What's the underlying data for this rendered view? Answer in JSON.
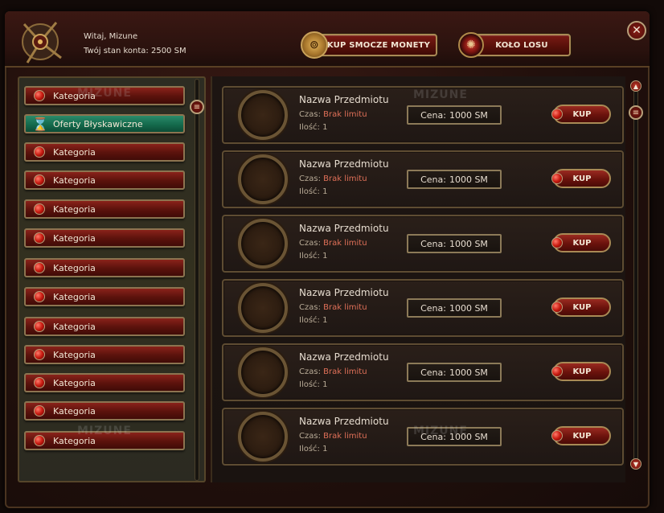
{
  "header": {
    "greeting": "Witaj, Mizune",
    "balance": "Twój stan konta: 2500 SM",
    "buy_coins_label": "KUP SMOCZE MONETY",
    "wheel_label": "KOŁO LOSU",
    "close_symbol": "✕"
  },
  "sidebar": {
    "items": [
      {
        "label": "Kategoria",
        "active": false
      },
      {
        "label": "Oferty Błyskawiczne",
        "active": true
      },
      {
        "label": "Kategoria",
        "active": false
      },
      {
        "label": "Kategoria",
        "active": false
      },
      {
        "label": "Kategoria",
        "active": false
      },
      {
        "label": "Kategoria",
        "active": false
      },
      {
        "label": "Kategoria",
        "active": false
      },
      {
        "label": "Kategoria",
        "active": false
      },
      {
        "label": "Kategoria",
        "active": false
      },
      {
        "label": "Kategoria",
        "active": false
      },
      {
        "label": "Kategoria",
        "active": false
      },
      {
        "label": "Kategoria",
        "active": false
      },
      {
        "label": "Kategoria",
        "active": false
      }
    ]
  },
  "items": [
    {
      "name": "Nazwa Przedmiotu",
      "time_label": "Czas:",
      "time_value": "Brak limitu",
      "qty": "Ilość: 1",
      "price_label": "Cena:",
      "price_value": "1000 SM",
      "buy_label": "KUP"
    },
    {
      "name": "Nazwa Przedmiotu",
      "time_label": "Czas:",
      "time_value": "Brak limitu",
      "qty": "Ilość: 1",
      "price_label": "Cena:",
      "price_value": "1000 SM",
      "buy_label": "KUP"
    },
    {
      "name": "Nazwa Przedmiotu",
      "time_label": "Czas:",
      "time_value": "Brak limitu",
      "qty": "Ilość: 1",
      "price_label": "Cena:",
      "price_value": "1000 SM",
      "buy_label": "KUP"
    },
    {
      "name": "Nazwa Przedmiotu",
      "time_label": "Czas:",
      "time_value": "Brak limitu",
      "qty": "Ilość: 1",
      "price_label": "Cena:",
      "price_value": "1000 SM",
      "buy_label": "KUP"
    },
    {
      "name": "Nazwa Przedmiotu",
      "time_label": "Czas:",
      "time_value": "Brak limitu",
      "qty": "Ilość: 1",
      "price_label": "Cena:",
      "price_value": "1000 SM",
      "buy_label": "KUP"
    },
    {
      "name": "Nazwa Przedmiotu",
      "time_label": "Czas:",
      "time_value": "Brak limitu",
      "qty": "Ilość: 1",
      "price_label": "Cena:",
      "price_value": "1000 SM",
      "buy_label": "KUP"
    }
  ],
  "watermark": "MIZUNE",
  "icons": {
    "emblem": "dragon-emblem-icon",
    "coin": "dragon-coin-icon",
    "wheel": "wheel-icon",
    "gem": "red-gem-icon",
    "hourglass": "hourglass-icon",
    "scroll_knob": "scroll-handle-icon"
  },
  "colors": {
    "accent_red": "#7a1a14",
    "active_green": "#146a4c",
    "gold_border": "#a98a55",
    "limit_text": "#e07058"
  }
}
